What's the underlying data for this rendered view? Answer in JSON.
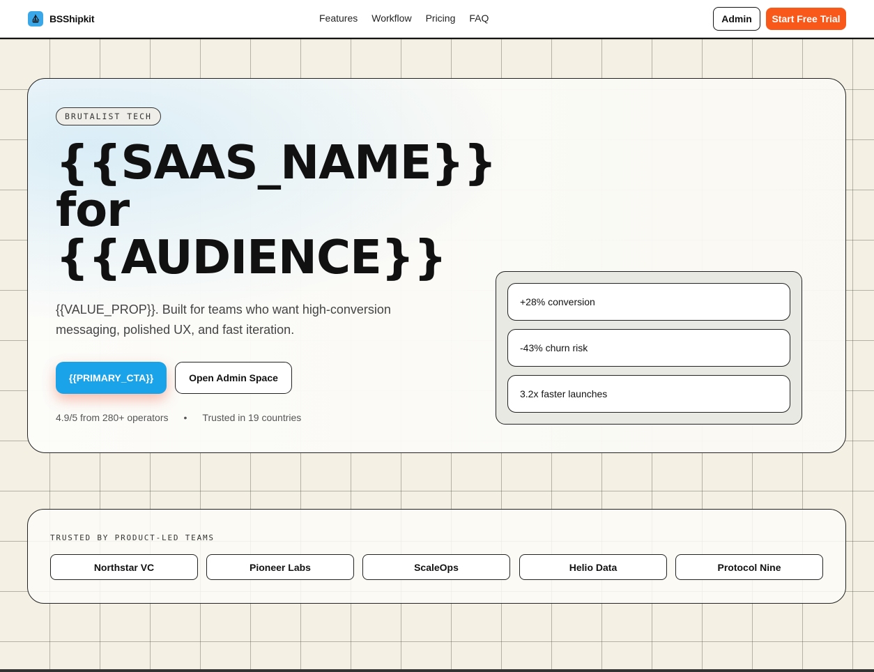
{
  "header": {
    "brand": "BSShipkit",
    "nav": [
      "Features",
      "Workflow",
      "Pricing",
      "FAQ"
    ],
    "admin_label": "Admin",
    "trial_label": "Start Free Trial"
  },
  "hero": {
    "tag": "BRUTALIST TECH",
    "headline_line1": "{{SAAS_NAME}}",
    "headline_line2": "for",
    "headline_line3": "{{AUDIENCE}}",
    "value_prop": "{{VALUE_PROP}}. Built for teams who want high-conversion messaging, polished UX, and fast iteration.",
    "primary_cta": "{{PRIMARY_CTA}}",
    "secondary_cta": "Open Admin Space",
    "rating_text": "4.9/5 from 280+ operators",
    "separator": "•",
    "trust_text": "Trusted in 19 countries",
    "stats": [
      "+28% conversion",
      "-43% churn risk",
      "3.2x faster launches"
    ]
  },
  "trusted": {
    "label": "TRUSTED BY PRODUCT-LED TEAMS",
    "logos": [
      "Northstar VC",
      "Pioneer Labs",
      "ScaleOps",
      "Helio Data",
      "Protocol Nine"
    ]
  },
  "colors": {
    "accent_orange": "#f8581a",
    "primary_blue": "#1ba3ea",
    "background": "#f4f1e4"
  }
}
